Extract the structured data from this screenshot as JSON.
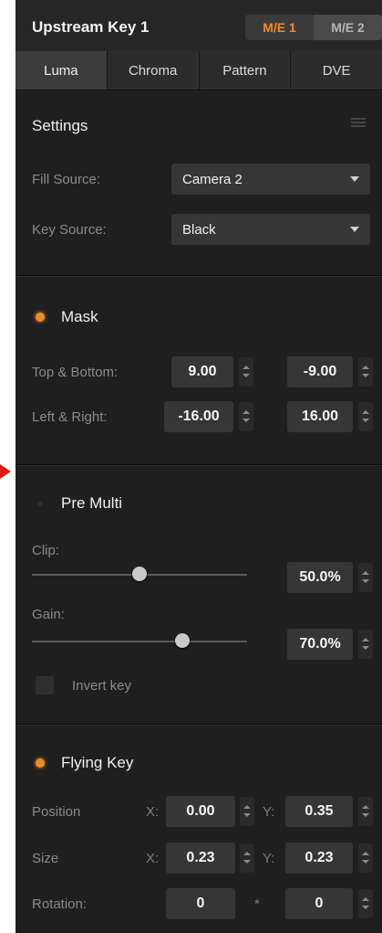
{
  "header": {
    "title": "Upstream Key 1",
    "me_tabs": [
      {
        "label": "M/E 1",
        "active": true
      },
      {
        "label": "M/E 2",
        "active": false
      }
    ]
  },
  "tabs": [
    {
      "label": "Luma",
      "active": true
    },
    {
      "label": "Chroma",
      "active": false
    },
    {
      "label": "Pattern",
      "active": false
    },
    {
      "label": "DVE",
      "active": false
    }
  ],
  "settings": {
    "title": "Settings",
    "fill_source": {
      "label": "Fill Source:",
      "value": "Camera 2"
    },
    "key_source": {
      "label": "Key Source:",
      "value": "Black"
    }
  },
  "mask": {
    "title": "Mask",
    "enabled": true,
    "top_bottom": {
      "label": "Top & Bottom:",
      "a": "9.00",
      "b": "-9.00"
    },
    "left_right": {
      "label": "Left & Right:",
      "a": "-16.00",
      "b": "16.00"
    }
  },
  "premulti": {
    "title": "Pre Multi",
    "enabled": false,
    "clip": {
      "label": "Clip:",
      "value": "50.0%",
      "level": 0.5
    },
    "gain": {
      "label": "Gain:",
      "value": "70.0%",
      "level": 0.7
    },
    "invert_key": {
      "label": "Invert key",
      "checked": false
    }
  },
  "flying_key": {
    "title": "Flying Key",
    "enabled": true,
    "position": {
      "label": "Position",
      "x_label": "X:",
      "x": "0.00",
      "y_label": "Y:",
      "y": "0.35"
    },
    "size": {
      "label": "Size",
      "x_label": "X:",
      "x": "0.23",
      "y_label": "Y:",
      "y": "0.23"
    },
    "rotation": {
      "label": "Rotation:",
      "a": "0",
      "sep": "*",
      "b": "0"
    }
  },
  "colors": {
    "accent": "#f08a24",
    "panel": "#1f1f1f",
    "arrow": "#e31b14"
  }
}
